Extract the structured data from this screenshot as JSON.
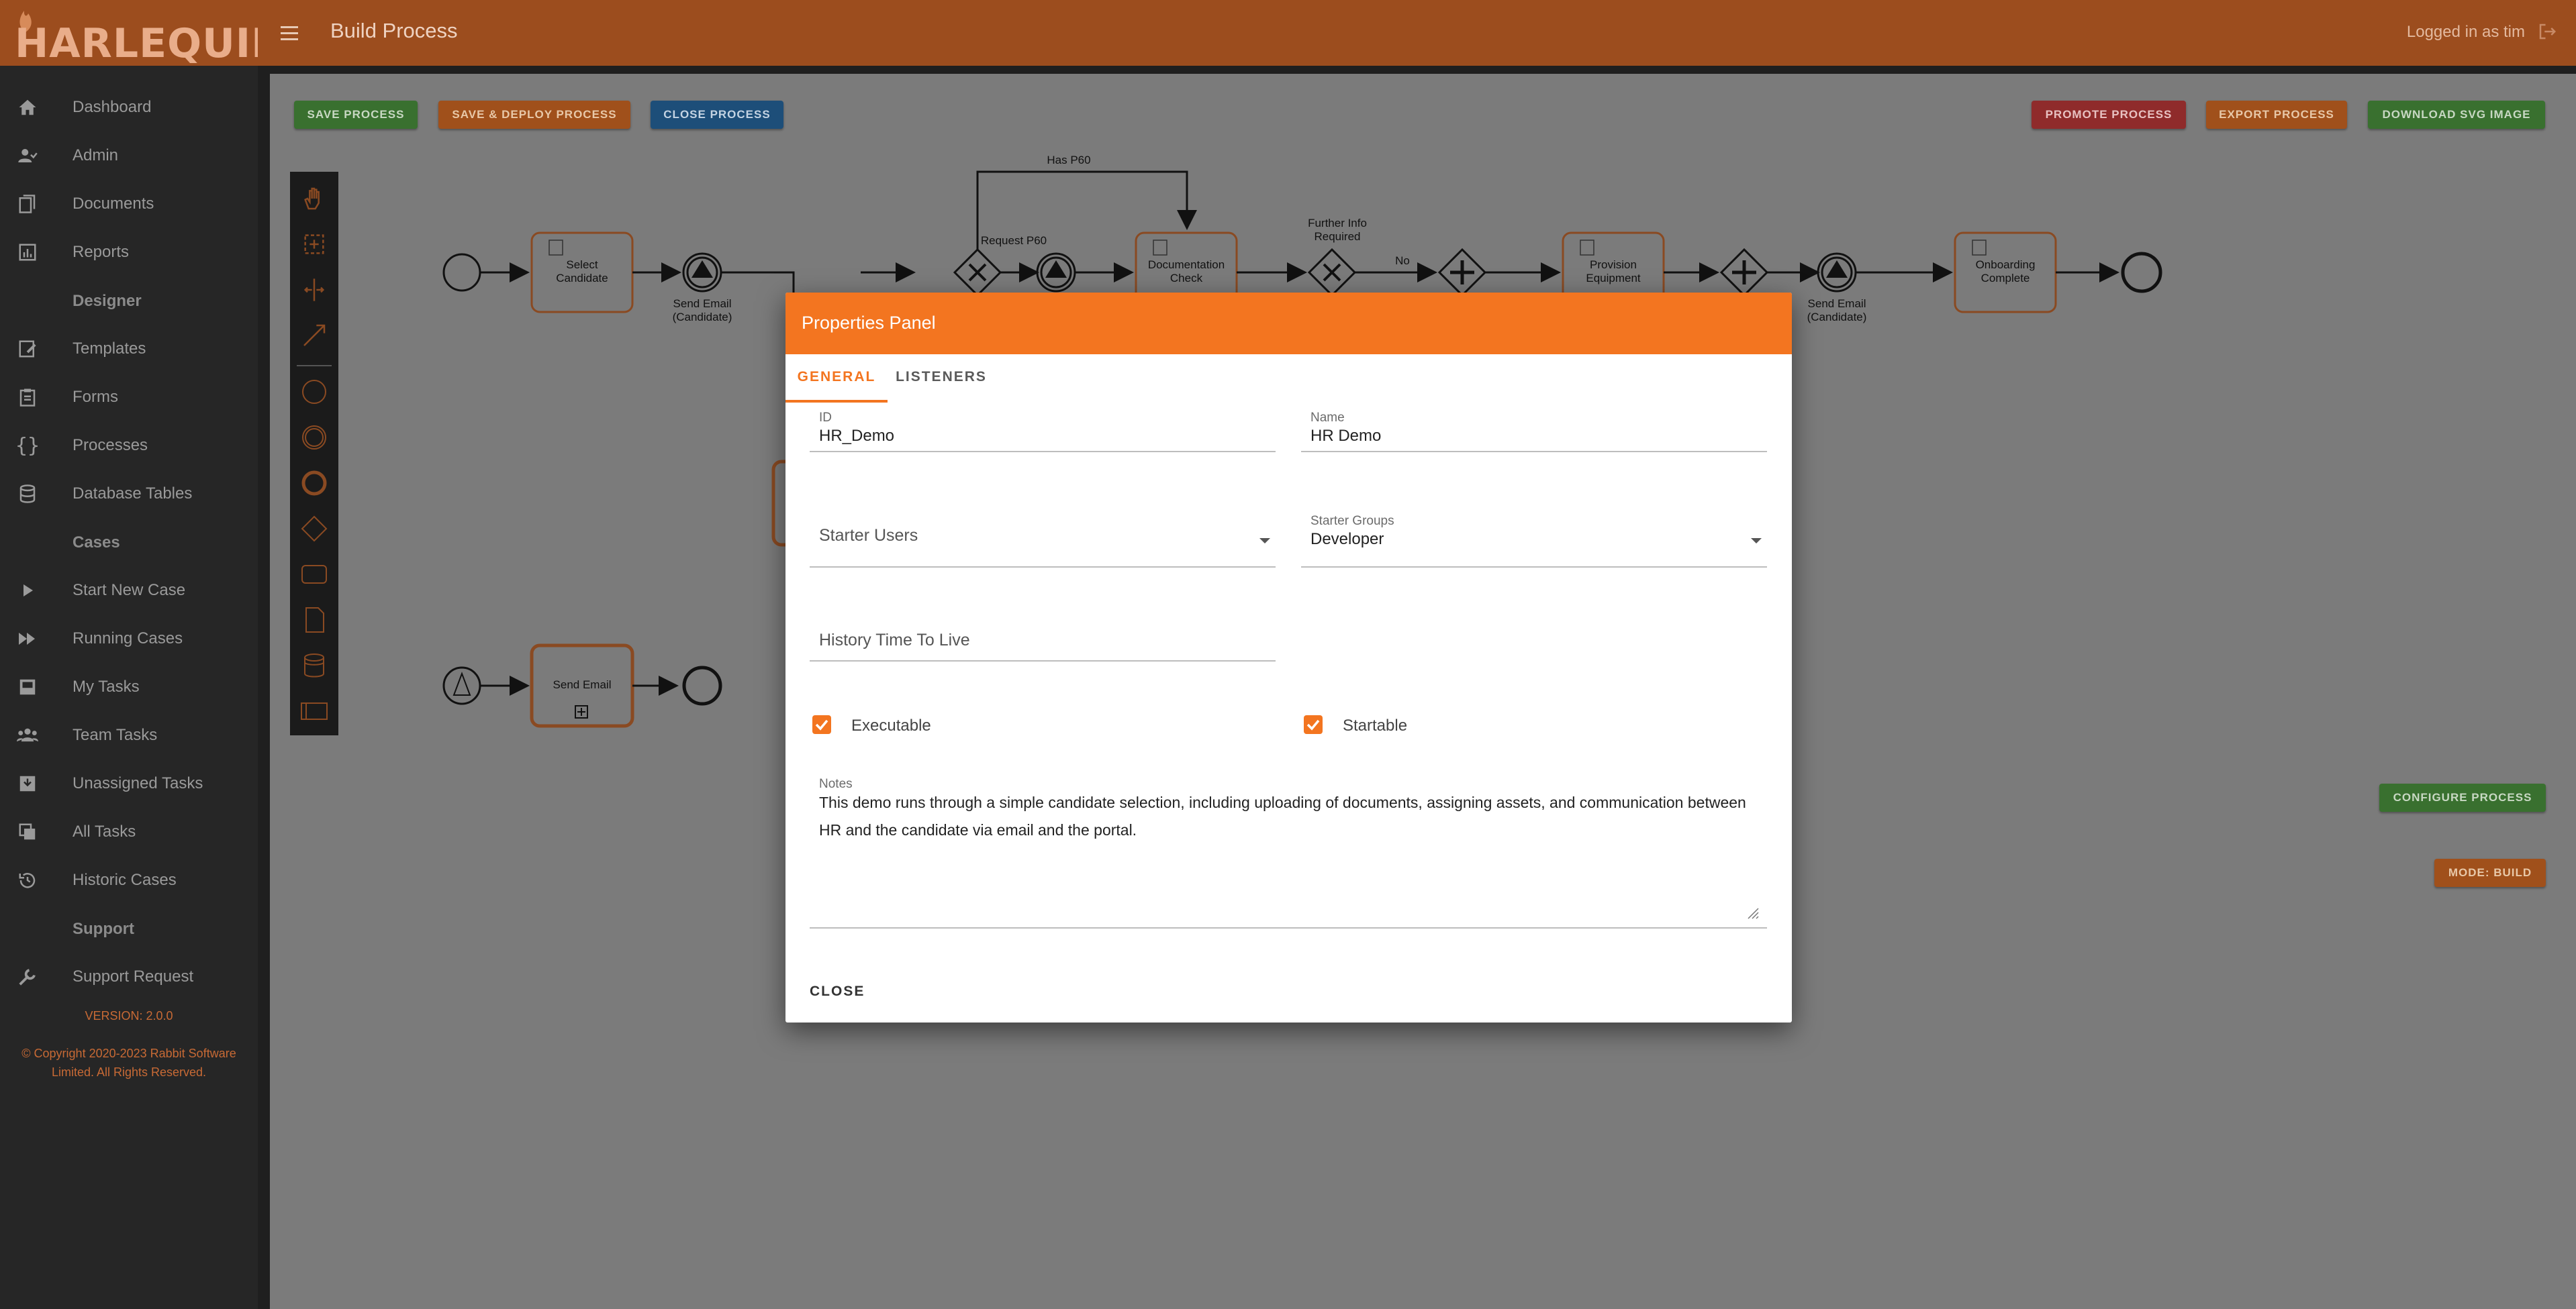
{
  "brand": {
    "logo_text": "HARLEQUIN"
  },
  "header": {
    "title": "Build Process",
    "user_text": "Logged in as tim"
  },
  "sidebar": {
    "items": [
      {
        "label": "Dashboard",
        "icon": "home-icon"
      },
      {
        "label": "Admin",
        "icon": "users-icon"
      },
      {
        "label": "Documents",
        "icon": "documents-icon"
      },
      {
        "label": "Reports",
        "icon": "chart-icon"
      }
    ],
    "designer_section": "Designer",
    "designer_items": [
      {
        "label": "Templates",
        "icon": "template-icon"
      },
      {
        "label": "Forms",
        "icon": "clipboard-icon"
      },
      {
        "label": "Processes",
        "icon": "braces-icon"
      },
      {
        "label": "Database Tables",
        "icon": "database-icon"
      }
    ],
    "cases_section": "Cases",
    "cases_items": [
      {
        "label": "Start New Case",
        "icon": "play-icon"
      },
      {
        "label": "Running Cases",
        "icon": "fast-forward-icon"
      },
      {
        "label": "My Tasks",
        "icon": "inbox-icon"
      },
      {
        "label": "Team Tasks",
        "icon": "team-icon"
      },
      {
        "label": "Unassigned Tasks",
        "icon": "inbox-down-icon"
      },
      {
        "label": "All Tasks",
        "icon": "copy-icon"
      },
      {
        "label": "Historic Cases",
        "icon": "history-icon"
      }
    ],
    "support_section": "Support",
    "support_items": [
      {
        "label": "Support Request",
        "icon": "wrench-icon"
      }
    ],
    "version": "VERSION: 2.0.0",
    "copyright": "© Copyright 2020-2023 Rabbit Software Limited. All Rights Reserved."
  },
  "toolbar": {
    "save": "SAVE PROCESS",
    "save_deploy": "SAVE & DEPLOY PROCESS",
    "close_process": "CLOSE PROCESS",
    "promote": "PROMOTE PROCESS",
    "export": "EXPORT PROCESS",
    "download_svg": "DOWNLOAD SVG IMAGE",
    "configure": "CONFIGURE PROCESS",
    "mode": "MODE: BUILD"
  },
  "diagram": {
    "labels": {
      "select_candidate_1": "Select",
      "select_candidate_2": "Candidate",
      "send_email_1": "Send Email",
      "send_email_2": "(Candidate)",
      "has_p60": "Has P60",
      "request_p60": "Request P60",
      "doc_check_1": "Documentation",
      "doc_check_2": "Check",
      "further_info_1": "Further Info",
      "further_info_2": "Required",
      "no": "No",
      "provision_1": "Provision",
      "provision_2": "Equipment",
      "send_email_b_1": "Send Email",
      "send_email_b_2": "(Candidate)",
      "onboarding_1": "Onboarding",
      "onboarding_2": "Complete",
      "subprocess": "Send Email"
    }
  },
  "modal": {
    "title": "Properties Panel",
    "tabs": {
      "general": "GENERAL",
      "listeners": "LISTENERS"
    },
    "id_label": "ID",
    "id_value": "HR_Demo",
    "name_label": "Name",
    "name_value": "HR Demo",
    "starter_users_placeholder": "Starter Users",
    "starter_groups_label": "Starter Groups",
    "starter_groups_value": "Developer",
    "history_placeholder": "History Time To Live",
    "executable_label": "Executable",
    "executable_checked": true,
    "startable_label": "Startable",
    "startable_checked": true,
    "notes_label": "Notes",
    "notes_value": "This demo runs through a simple candidate selection, including uploading of documents, assigning assets, and communication between HR and the candidate via email and the portal.",
    "close_label": "CLOSE"
  },
  "colors": {
    "accent": "#f37520",
    "header": "#9c4d1e",
    "sidebar": "#262626"
  }
}
